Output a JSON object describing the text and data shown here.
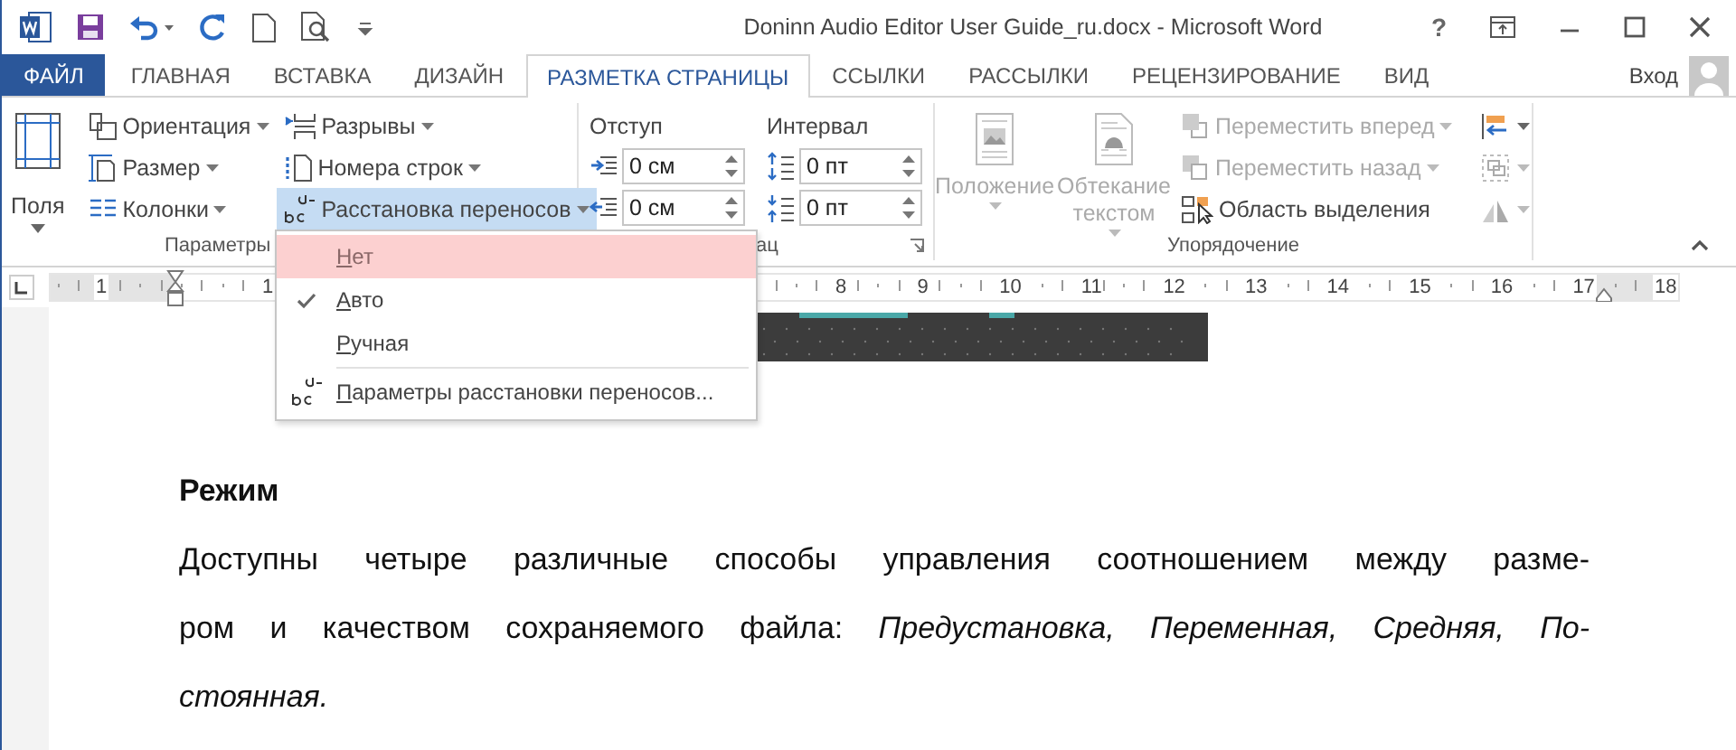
{
  "title_bar": {
    "title": "Doninn Audio Editor User Guide_ru.docx - Microsoft Word",
    "help": "?"
  },
  "tabs": [
    {
      "label": "ФАЙЛ",
      "kind": "file",
      "selected": false
    },
    {
      "label": "ГЛАВНАЯ",
      "kind": "tab",
      "selected": false
    },
    {
      "label": "ВСТАВКА",
      "kind": "tab",
      "selected": false
    },
    {
      "label": "ДИЗАЙН",
      "kind": "tab",
      "selected": false
    },
    {
      "label": "РАЗМЕТКА СТРАНИЦЫ",
      "kind": "tab",
      "selected": true
    },
    {
      "label": "ССЫЛКИ",
      "kind": "tab",
      "selected": false
    },
    {
      "label": "РАССЫЛКИ",
      "kind": "tab",
      "selected": false
    },
    {
      "label": "РЕЦЕНЗИРОВАНИЕ",
      "kind": "tab",
      "selected": false
    },
    {
      "label": "ВИД",
      "kind": "tab",
      "selected": false
    }
  ],
  "sign_in": "Вход",
  "page_setup": {
    "label": "Параметры",
    "margins": "Поля",
    "column_1": [
      {
        "label": "Ориентация",
        "expanded": false
      },
      {
        "label": "Размер",
        "expanded": false
      },
      {
        "label": "Колонки",
        "expanded": false
      }
    ],
    "column_2": [
      {
        "label": "Разрывы",
        "expanded": false
      },
      {
        "label": "Номера строк",
        "expanded": false
      },
      {
        "label": "Расстановка переносов",
        "expanded": true
      }
    ]
  },
  "paragraph": {
    "label": "ац",
    "indent": {
      "label": "Отступ",
      "fields": [
        "0 см",
        "0 см"
      ]
    },
    "spacing": {
      "label": "Интервал",
      "fields": [
        "0 пт",
        "0 пт"
      ]
    }
  },
  "arrange": {
    "label": "Упорядочение",
    "large": [
      {
        "label": "Положение",
        "disabled": true
      },
      {
        "label": "Обтекание текстом",
        "disabled": true
      }
    ],
    "small": [
      {
        "label": "Переместить вперед",
        "disabled": true
      },
      {
        "label": "Переместить назад",
        "disabled": true
      },
      {
        "label": "Область выделения",
        "disabled": false
      }
    ],
    "icons": [
      {
        "disabled": false
      },
      {
        "disabled": true
      },
      {
        "disabled": true
      }
    ]
  },
  "ruler": {
    "before_indent": [
      "1"
    ],
    "after_indent": [
      "1"
    ],
    "after_menu": [
      "8",
      "9",
      "10",
      "11",
      "12",
      "13",
      "14",
      "15",
      "16",
      "17",
      "18"
    ]
  },
  "menu": {
    "items": [
      {
        "label": "Нет",
        "kind": "option",
        "highlighted": true,
        "checked": false
      },
      {
        "label": "Авто",
        "kind": "option",
        "highlighted": false,
        "checked": true
      },
      {
        "label": "Ручная",
        "kind": "option",
        "highlighted": false,
        "checked": false
      },
      {
        "kind": "separator"
      },
      {
        "label": "Параметры расстановки переносов...",
        "kind": "command",
        "highlighted": false,
        "checked": false
      }
    ]
  },
  "document": {
    "heading": "Режим",
    "paragraph_lines": [
      "Доступны четыре различные способы управления соотношением между разме-",
      "ром и качеством сохраняемого файла: *Предустановка, Переменная, Средняя, По-*",
      "*стоянная.*"
    ]
  }
}
